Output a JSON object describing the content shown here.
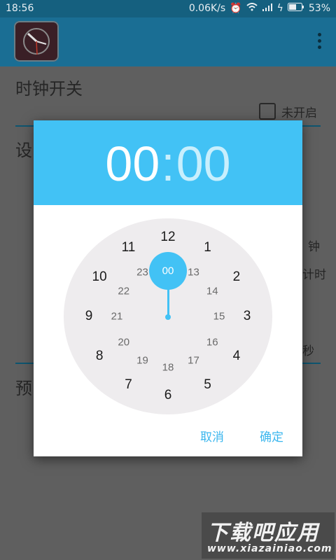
{
  "status_bar": {
    "time": "18:56",
    "network_speed": "0.06K/s",
    "battery": "53%",
    "icons": [
      "alarm-icon",
      "wifi-icon",
      "signal-icon",
      "charging-icon",
      "battery-icon"
    ]
  },
  "app_bar": {
    "icon": "clock-app-icon",
    "menu_icon": "overflow-menu-icon"
  },
  "background": {
    "section_title": "时钟开关",
    "toggle_label": "未开启",
    "section2_title_fragment": "设",
    "right_label_1": "钟",
    "right_label_2": "计时",
    "right_label_3": "秒",
    "section3_title_fragment": "预"
  },
  "dialog": {
    "hour": "00",
    "minute": "00",
    "separator": ":",
    "selected_value": "00",
    "outer_numbers": [
      "12",
      "1",
      "2",
      "3",
      "4",
      "5",
      "6",
      "7",
      "8",
      "9",
      "10",
      "11"
    ],
    "inner_numbers": [
      "13",
      "14",
      "15",
      "16",
      "17",
      "18",
      "19",
      "20",
      "21",
      "22",
      "23"
    ],
    "cancel_label": "取消",
    "ok_label": "确定"
  },
  "watermark": {
    "main": "下载吧应用",
    "sub": "www.xiazainiao.com"
  },
  "colors": {
    "accent": "#42c2f5",
    "header_bg": "#1a6e94"
  }
}
